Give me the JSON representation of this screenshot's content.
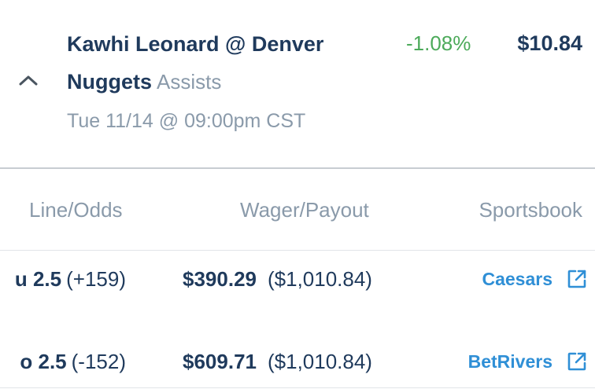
{
  "bet": {
    "title_line1": "Kawhi Leonard @ Denver",
    "title_line2": "Nuggets",
    "market": "Assists",
    "datetime": "Tue 11/14 @ 09:00pm CST",
    "change": "-1.08%",
    "price": "$10.84",
    "expand_icon": "chevron-up-icon"
  },
  "table": {
    "headers": {
      "line_odds": "Line/Odds",
      "wager_payout": "Wager/Payout",
      "sportsbook": "Sportsbook"
    },
    "rows": [
      {
        "line": "u 2.5",
        "odds": "(+159)",
        "wager": "$390.29",
        "payout": "($1,010.84)",
        "sportsbook": "Caesars",
        "icon": "external-link-icon"
      },
      {
        "line": "o 2.5",
        "odds": "(-152)",
        "wager": "$609.71",
        "payout": "($1,010.84)",
        "sportsbook": "BetRivers",
        "icon": "external-link-icon"
      }
    ]
  },
  "colors": {
    "primary_text": "#1f3a5c",
    "muted_text": "#8a9aaa",
    "positive_change": "#4caa5a",
    "link": "#2f8fd6"
  }
}
